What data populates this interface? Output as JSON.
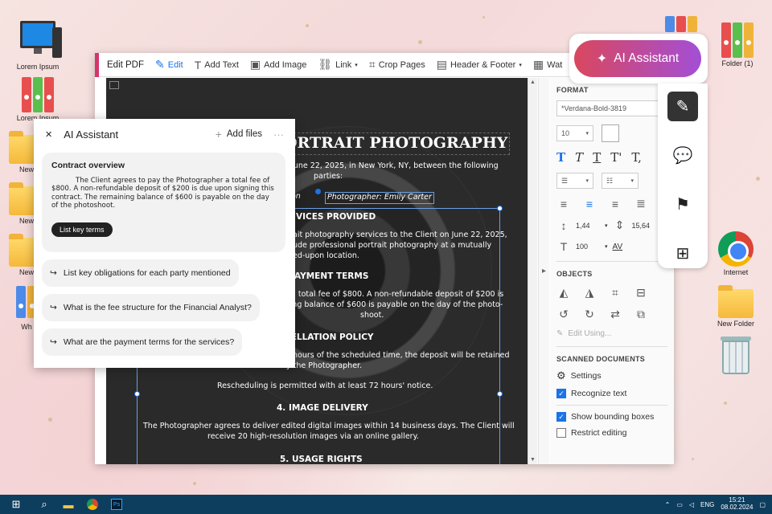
{
  "desktop": {
    "icons": [
      {
        "label": "Lorem Ipsum"
      },
      {
        "label": "Lorem Ipsum"
      },
      {
        "label": "New"
      },
      {
        "label": "New"
      },
      {
        "label": "New"
      },
      {
        "label": "Wh"
      },
      {
        "label": "Folder (1)"
      },
      {
        "label": "Internet"
      },
      {
        "label": "New Folder"
      }
    ]
  },
  "toolbar": {
    "title": "Edit PDF",
    "items": [
      "Edit",
      "Add Text",
      "Add Image",
      "Link",
      "Crop Pages",
      "Header & Footer",
      "Wat"
    ]
  },
  "document": {
    "title": "ORTRAIT PHOTOGRAPHY",
    "intro": "June 22, 2025, in New York, NY, between the following",
    "parties": "parties:",
    "party_a": "on",
    "party_b": "Photographer: Emily Carter",
    "sec1": "VICES PROVIDED",
    "p1": "ait photography services to the Client on June 22, 2025,",
    "p1b": "ude professional portrait photography at a mutually",
    "p1c": "ed-upon location.",
    "sec2": "AYMENT TERMS",
    "p2": "a total fee of $800. A non-refundable deposit of $200 is",
    "p2b": "ining balance of $600 is payable on the day of the photo-",
    "p2c": "shoot.",
    "sec3": "CELLATION POLICY",
    "p3": "hours of the scheduled time, the deposit will be retained",
    "p3b": "by the Photographer.",
    "p3c": "Rescheduling is permitted with at least 72 hours' notice.",
    "sec4": "4. IMAGE DELIVERY",
    "p4": "The Photographer agrees to deliver edited digital images within 14 business days. The Client will",
    "p4b": "receive 20 high-resolution images via an online gallery.",
    "sec5": "5. USAGE RIGHTS"
  },
  "panel": {
    "format": "FORMAT",
    "font": "*Verdana-Bold-3819",
    "size": "10",
    "line_spacing": "1,44",
    "char_spacing": "15,64",
    "scale": "100",
    "objects": "OBJECTS",
    "edit_using": "Edit Using...",
    "scanned": "SCANNED DOCUMENTS",
    "settings": "Settings",
    "recognize": "Recognize text",
    "bounding": "Show bounding boxes",
    "restrict": "Restrict editing"
  },
  "ai_panel": {
    "close": "✕",
    "title": "AI Assistant",
    "add_files": "Add files",
    "more": "···",
    "card_title": "Contract overview",
    "card_text": "The Client agrees to pay the Photographer a total fee of $800. A non-refundable deposit of $200 is due upon signing this contract. The remaining balance of $600 is payable on the day of the photoshoot.",
    "pill": "List key terms",
    "suggestions": [
      "List key obligations for each party mentioned",
      "What is the fee structure for the Financial Analyst?",
      "What are the payment terms for the services?"
    ]
  },
  "ai_button": {
    "label": "AI Assistant"
  },
  "taskbar": {
    "lang": "ENG",
    "time": "15:21",
    "date": "08.02.2024"
  }
}
